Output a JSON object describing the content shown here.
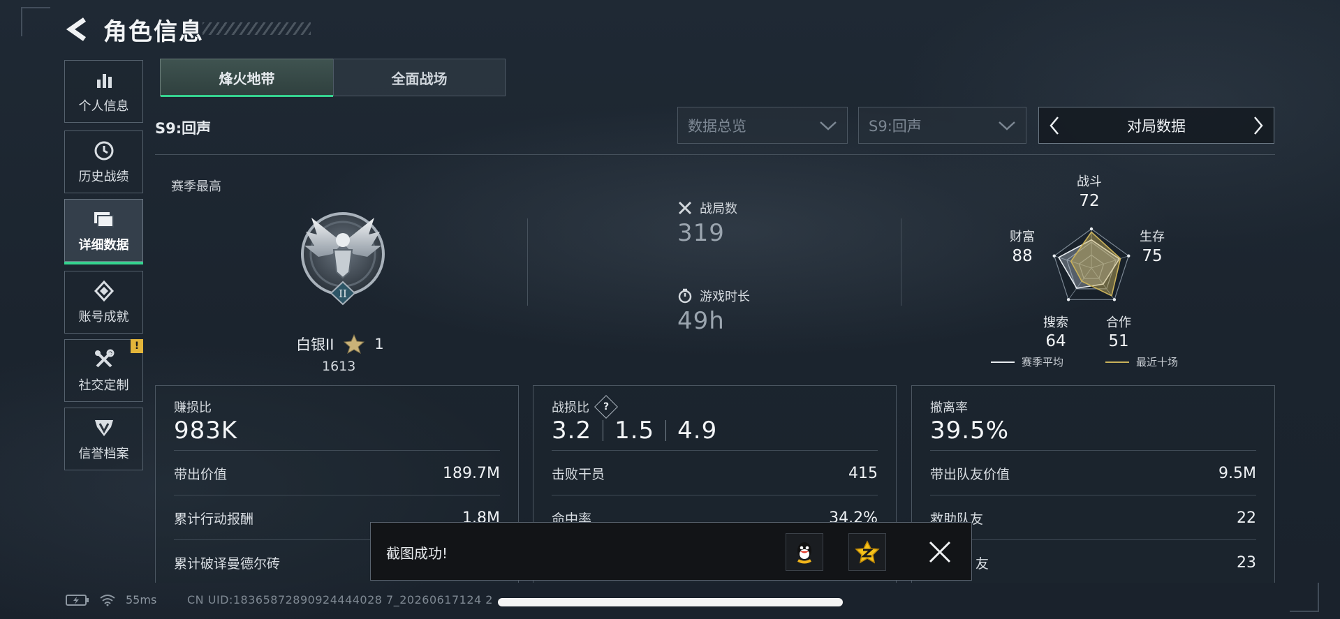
{
  "header": {
    "title": "角色信息"
  },
  "sidebar": {
    "items": [
      {
        "label": "个人信息",
        "icon": "bar-chart-icon"
      },
      {
        "label": "历史战绩",
        "icon": "clock-history-icon"
      },
      {
        "label": "详细数据",
        "icon": "folder-icon",
        "active": true
      },
      {
        "label": "账号成就",
        "icon": "medal-icon"
      },
      {
        "label": "社交定制",
        "icon": "tools-icon",
        "badge": "!"
      },
      {
        "label": "信誉档案",
        "icon": "shield-icon"
      }
    ]
  },
  "tabs": [
    {
      "label": "烽火地带",
      "active": true
    },
    {
      "label": "全面战场"
    }
  ],
  "season_label": "S9:回声",
  "filters": {
    "view": "数据总览",
    "season": "S9:回声",
    "category": "对局数据"
  },
  "rank": {
    "heading": "赛季最高",
    "name": "白银II",
    "stars": "1",
    "score": "1613",
    "tier_numeral": "II"
  },
  "overview": {
    "matches_label": "战局数",
    "matches_value": "319",
    "playtime_label": "游戏时长",
    "playtime_value": "49h"
  },
  "radar": {
    "axes": [
      {
        "label": "战斗",
        "value": "72"
      },
      {
        "label": "生存",
        "value": "75"
      },
      {
        "label": "合作",
        "value": "51"
      },
      {
        "label": "搜索",
        "value": "64"
      },
      {
        "label": "财富",
        "value": "88"
      }
    ],
    "legend_season": "赛季平均",
    "legend_recent": "最近十场",
    "season_color": "#e8ecf0",
    "recent_color": "#c9b15a"
  },
  "cards": {
    "profit": {
      "label": "赚损比",
      "value": "983K",
      "rows": [
        {
          "k": "带出价值",
          "v": "189.7M"
        },
        {
          "k": "累计行动报酬",
          "v": "1.8M"
        },
        {
          "k": "累计破译曼德尔砖",
          "v": ""
        }
      ]
    },
    "combat": {
      "label": "战损比",
      "values": [
        "3.2",
        "1.5",
        "4.9"
      ],
      "rows": [
        {
          "k": "击败干员",
          "v": "415"
        },
        {
          "k": "命中率",
          "v": "34.2%"
        },
        {
          "k": "",
          "v": ""
        }
      ]
    },
    "extract": {
      "label": "撤离率",
      "value": "39.5%",
      "rows": [
        {
          "k": "带出队友价值",
          "v": "9.5M"
        },
        {
          "k": "救助队友",
          "v": "22"
        },
        {
          "k": "友",
          "v": "23"
        }
      ]
    }
  },
  "toast": {
    "text": "截图成功!"
  },
  "footer": {
    "ping": "55ms",
    "uid": "CN UID:18365872890924444028 7_20260617124 2"
  }
}
